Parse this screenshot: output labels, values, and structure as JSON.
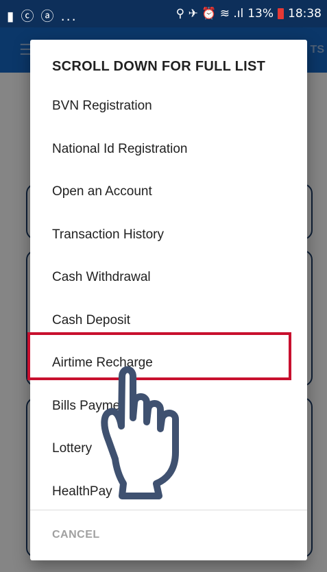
{
  "status_bar": {
    "left_icons": "▮ ⓒ ⓐ ...",
    "right_icons": "⚲ ✈ ⏰ ≋ .ıl",
    "battery_percent": "13%",
    "time": "18:38"
  },
  "app_bar": {
    "partial_title": "TS"
  },
  "dialog": {
    "title": "SCROLL DOWN FOR FULL LIST",
    "items": [
      {
        "label": "BVN Registration"
      },
      {
        "label": "National Id Registration"
      },
      {
        "label": "Open an Account"
      },
      {
        "label": "Transaction History"
      },
      {
        "label": "Cash Withdrawal"
      },
      {
        "label": "Cash Deposit"
      },
      {
        "label": "Airtime Recharge"
      },
      {
        "label": "Bills Payment"
      },
      {
        "label": "Lottery"
      },
      {
        "label": "HealthPay"
      }
    ],
    "cancel_label": "CANCEL"
  },
  "highlighted_item": "Airtime Recharge",
  "colors": {
    "status_bar": "#0d2f5a",
    "app_bar": "#1565c0",
    "highlight": "#c8102e",
    "hand_stroke": "#3f5170"
  }
}
